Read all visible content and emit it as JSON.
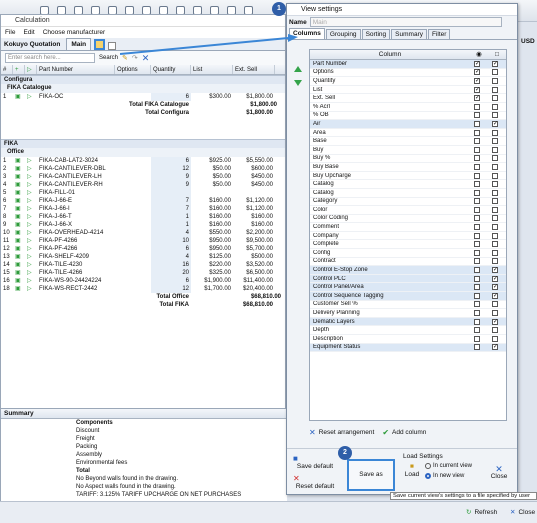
{
  "window_title": "Calculation",
  "menu": [
    "File",
    "Edit",
    "Choose manufacturer"
  ],
  "quote_label": "Kokuyo Quotation",
  "main_tab": "Main",
  "search": {
    "placeholder": "Enter search here...",
    "button": "Search"
  },
  "grid_headers": [
    "#",
    "",
    "",
    "Part Number",
    "Options",
    "Quantity",
    "List",
    "Ext. Sell"
  ],
  "groups": [
    {
      "name": "Configura",
      "subgroups": [
        {
          "name": "FIKA Catalogue",
          "rows": [
            {
              "n": "1",
              "part": "FIKA-OC",
              "qty": "6",
              "list": "$300.00",
              "ext": "$1,800.00"
            }
          ],
          "total_label": "Total FIKA Catalogue",
          "total_qty": "6",
          "total_ext": "$1,800.00"
        }
      ],
      "total_label": "Total Configura",
      "total_ext": "$1,800.00"
    },
    {
      "name": "FIKA",
      "subgroups": [
        {
          "name": "Office",
          "rows": [
            {
              "n": "1",
              "part": "FIKA-CAB-LAT2-3024",
              "qty": "6",
              "list": "$925.00",
              "ext": "$5,550.00"
            },
            {
              "n": "2",
              "part": "FIKA-CANTILEVER-DBL",
              "qty": "12",
              "list": "$50.00",
              "ext": "$600.00"
            },
            {
              "n": "3",
              "part": "FIKA-CANTILEVER-LH",
              "qty": "9",
              "list": "$50.00",
              "ext": "$450.00"
            },
            {
              "n": "4",
              "part": "FIKA-CANTILEVER-RH",
              "qty": "9",
              "list": "$50.00",
              "ext": "$450.00"
            },
            {
              "n": "5",
              "part": "FIKA-FILL-01",
              "qty": "",
              "list": "",
              "ext": ""
            },
            {
              "n": "6",
              "part": "FIKA-J-66-E",
              "qty": "7",
              "list": "$160.00",
              "ext": "$1,120.00"
            },
            {
              "n": "7",
              "part": "FIKA-J-66-I",
              "qty": "7",
              "list": "$160.00",
              "ext": "$1,120.00"
            },
            {
              "n": "8",
              "part": "FIKA-J-66-T",
              "qty": "1",
              "list": "$160.00",
              "ext": "$160.00"
            },
            {
              "n": "9",
              "part": "FIKA-J-66-X",
              "qty": "1",
              "list": "$160.00",
              "ext": "$160.00"
            },
            {
              "n": "10",
              "part": "FIKA-OVERHEAD-4214",
              "qty": "4",
              "list": "$550.00",
              "ext": "$2,200.00"
            },
            {
              "n": "11",
              "part": "FIKA-PF-4266",
              "qty": "10",
              "list": "$950.00",
              "ext": "$9,500.00"
            },
            {
              "n": "12",
              "part": "FIKA-PF-4266",
              "qty": "6",
              "list": "$950.00",
              "ext": "$5,700.00"
            },
            {
              "n": "13",
              "part": "FIKA-SHELF-4209",
              "qty": "4",
              "list": "$125.00",
              "ext": "$500.00"
            },
            {
              "n": "14",
              "part": "FIKA-TILE-4230",
              "qty": "16",
              "list": "$220.00",
              "ext": "$3,520.00"
            },
            {
              "n": "15",
              "part": "FIKA-TILE-4266",
              "qty": "20",
              "list": "$325.00",
              "ext": "$6,500.00"
            },
            {
              "n": "16",
              "part": "FIKA-WS-90-24424224",
              "qty": "6",
              "list": "$1,900.00",
              "ext": "$11,400.00"
            },
            {
              "n": "18",
              "part": "FIKA-WS-RECT-2442",
              "qty": "12",
              "list": "$1,700.00",
              "ext": "$20,400.00"
            }
          ],
          "total_label": "Total Office",
          "total_ext": "$68,810.00"
        }
      ],
      "total_label": "Total FIKA",
      "total_ext": "$68,810.00"
    }
  ],
  "summary": {
    "title": "Summary",
    "rows": [
      "Components",
      "Discount",
      "Freight",
      "Packing",
      "Assembly",
      "Environmental fees",
      "Total",
      "No Beyond walls found in the drawing.",
      "No Aspect walls found in the drawing.",
      "TARIFF: 3.125% TARIFF UPCHARGE ON NET PURCHASES"
    ]
  },
  "dialog": {
    "title": "View settings",
    "name_label": "Name",
    "name_value": "Main",
    "tabs": [
      "Columns",
      "Grouping",
      "Sorting",
      "Summary",
      "Filter"
    ],
    "column_header": "Column",
    "columns": [
      {
        "name": "Part Number",
        "c1": true,
        "c2": true
      },
      {
        "name": "Options",
        "c1": true,
        "c2": false
      },
      {
        "name": "Quantity",
        "c1": true,
        "c2": false
      },
      {
        "name": "List",
        "c1": true,
        "c2": false
      },
      {
        "name": "Ext. Sell",
        "c1": true,
        "c2": false
      },
      {
        "name": "% Acrl",
        "c1": false,
        "c2": false
      },
      {
        "name": "% OB",
        "c1": false,
        "c2": false
      },
      {
        "name": "Air",
        "c1": false,
        "c2": true
      },
      {
        "name": "Area",
        "c1": false,
        "c2": false
      },
      {
        "name": "Base",
        "c1": false,
        "c2": false
      },
      {
        "name": "Buy",
        "c1": false,
        "c2": false
      },
      {
        "name": "Buy %",
        "c1": false,
        "c2": false
      },
      {
        "name": "Buy Base",
        "c1": false,
        "c2": false
      },
      {
        "name": "Buy Upcharge",
        "c1": false,
        "c2": false
      },
      {
        "name": "Catalog",
        "c1": false,
        "c2": false
      },
      {
        "name": "Catalog",
        "c1": false,
        "c2": false
      },
      {
        "name": "Category",
        "c1": false,
        "c2": false
      },
      {
        "name": "Color",
        "c1": false,
        "c2": false
      },
      {
        "name": "Color Coding",
        "c1": false,
        "c2": false
      },
      {
        "name": "Comment",
        "c1": false,
        "c2": false
      },
      {
        "name": "Company",
        "c1": false,
        "c2": false
      },
      {
        "name": "Complete",
        "c1": false,
        "c2": false
      },
      {
        "name": "Config",
        "c1": false,
        "c2": false
      },
      {
        "name": "Contract",
        "c1": false,
        "c2": false
      },
      {
        "name": "Control E-Stop Zone",
        "c1": false,
        "c2": true
      },
      {
        "name": "Control PLC",
        "c1": false,
        "c2": true
      },
      {
        "name": "Control Panel/Area",
        "c1": false,
        "c2": true
      },
      {
        "name": "Control Sequence Tagging",
        "c1": false,
        "c2": true
      },
      {
        "name": "Customer Sell %",
        "c1": false,
        "c2": false
      },
      {
        "name": "Delivery Planning",
        "c1": false,
        "c2": false
      },
      {
        "name": "Dematic Layers",
        "c1": false,
        "c2": true
      },
      {
        "name": "Depth",
        "c1": false,
        "c2": false
      },
      {
        "name": "Description",
        "c1": false,
        "c2": false
      },
      {
        "name": "Equipment Status",
        "c1": false,
        "c2": true
      }
    ],
    "reset_arrangement": "Reset arrangement",
    "add_column": "Add column",
    "save_default": "Save default",
    "reset_default": "Reset default",
    "save_as": "Save as",
    "load_settings": "Load Settings",
    "load": "Load",
    "in_current_view": "In current view",
    "in_new_view": "In new view",
    "close": "Close",
    "tooltip": "Save current view's settings to a file specified by user"
  },
  "badges": [
    "1",
    "2"
  ],
  "usd": "USD",
  "refresh": "Refresh",
  "close_main": "Close"
}
